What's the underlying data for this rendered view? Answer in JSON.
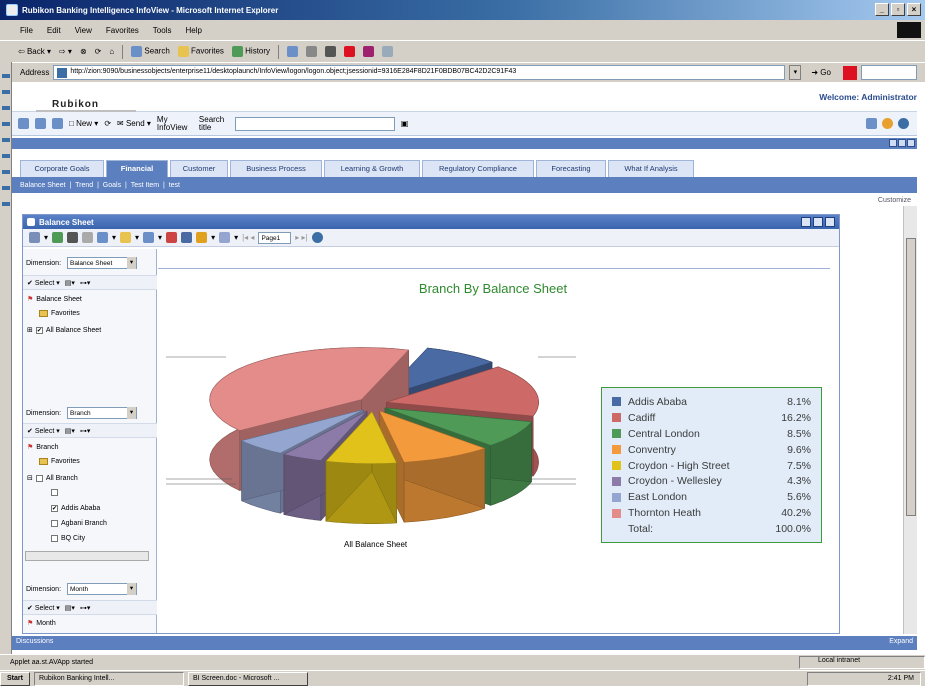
{
  "browser": {
    "title": "Rubikon Banking Intelligence InfoView - Microsoft Internet Explorer",
    "menus": [
      "File",
      "Edit",
      "View",
      "Favorites",
      "Tools",
      "Help"
    ],
    "toolbar": {
      "back": "Back",
      "search": "Search",
      "favorites": "Favorites",
      "history": "History"
    },
    "address_label": "Address",
    "url": "http://zion:9090/businessobjects/enterprise11/desktoplaunch/InfoView/logon/logon.object;jsessionid=9316E284F8D21F0BDB07BC42D2C91F43",
    "go_label": "Go"
  },
  "app": {
    "brand": "Rubikon",
    "welcome": "Welcome: Administrator",
    "toolbar": {
      "new": "New",
      "send": "Send",
      "my_infoview": "My InfoView",
      "search_label": "Search title"
    }
  },
  "tabs": [
    {
      "label": "Corporate Goals",
      "active": false
    },
    {
      "label": "Financial",
      "active": true
    },
    {
      "label": "Customer",
      "active": false
    },
    {
      "label": "Business Process",
      "active": false
    },
    {
      "label": "Learning & Growth",
      "active": false
    },
    {
      "label": "Regulatory Compliance",
      "active": false
    },
    {
      "label": "Forecasting",
      "active": false
    },
    {
      "label": "What If Analysis",
      "active": false
    }
  ],
  "subnav": [
    "Balance Sheet",
    "Trend",
    "Goals",
    "Test Item",
    "test"
  ],
  "customize": "Customize",
  "portlet": {
    "title": "Balance Sheet",
    "page_value": "Page1"
  },
  "left_pane": {
    "dimension_label": "Dimension:",
    "select_label": "Select",
    "dim1": {
      "value": "Balance Sheet",
      "root": "Balance Sheet",
      "favorites": "Favorites",
      "all": "All Balance Sheet"
    },
    "dim2": {
      "value": "Branch",
      "root": "Branch",
      "favorites": "Favorites",
      "all": "All Branch",
      "items": [
        "Addis Ababa",
        "Agbani Branch",
        "BQ City"
      ],
      "checked": [
        true,
        false,
        false
      ]
    },
    "dim3": {
      "value": "Month",
      "root": "Month"
    }
  },
  "chart_data": {
    "type": "pie",
    "title": "Branch By Balance Sheet",
    "caption": "All Balance Sheet",
    "categories": [
      "Addis Ababa",
      "Cadiff",
      "Central London",
      "Conventry",
      "Croydon - High Street",
      "Croydon - Wellesley",
      "East London",
      "Thornton Heath"
    ],
    "values": [
      8.1,
      16.2,
      8.5,
      9.6,
      7.5,
      4.3,
      5.6,
      40.2
    ],
    "labels": [
      "8.1%",
      "16.2%",
      "8.5%",
      "9.6%",
      "7.5%",
      "4.3%",
      "5.6%",
      "40.2%"
    ],
    "colors": [
      "#4a6aa4",
      "#cd6a68",
      "#4f9a56",
      "#f29a3c",
      "#e0c21a",
      "#8c7aa8",
      "#94a6cf",
      "#e38c8a"
    ],
    "total_label": "Total:",
    "total_value": "100.0%",
    "legend": "right"
  },
  "discussions": {
    "label": "Discussions",
    "expand": "Expand"
  },
  "status": {
    "text": "Applet aa.st.AVApp started",
    "zone": "Local intranet"
  },
  "taskbar": {
    "start": "Start",
    "tasks": [
      "Rubikon Banking Intell...",
      "BI Screen.doc - Microsoft ..."
    ],
    "clock": "2:41 PM"
  }
}
